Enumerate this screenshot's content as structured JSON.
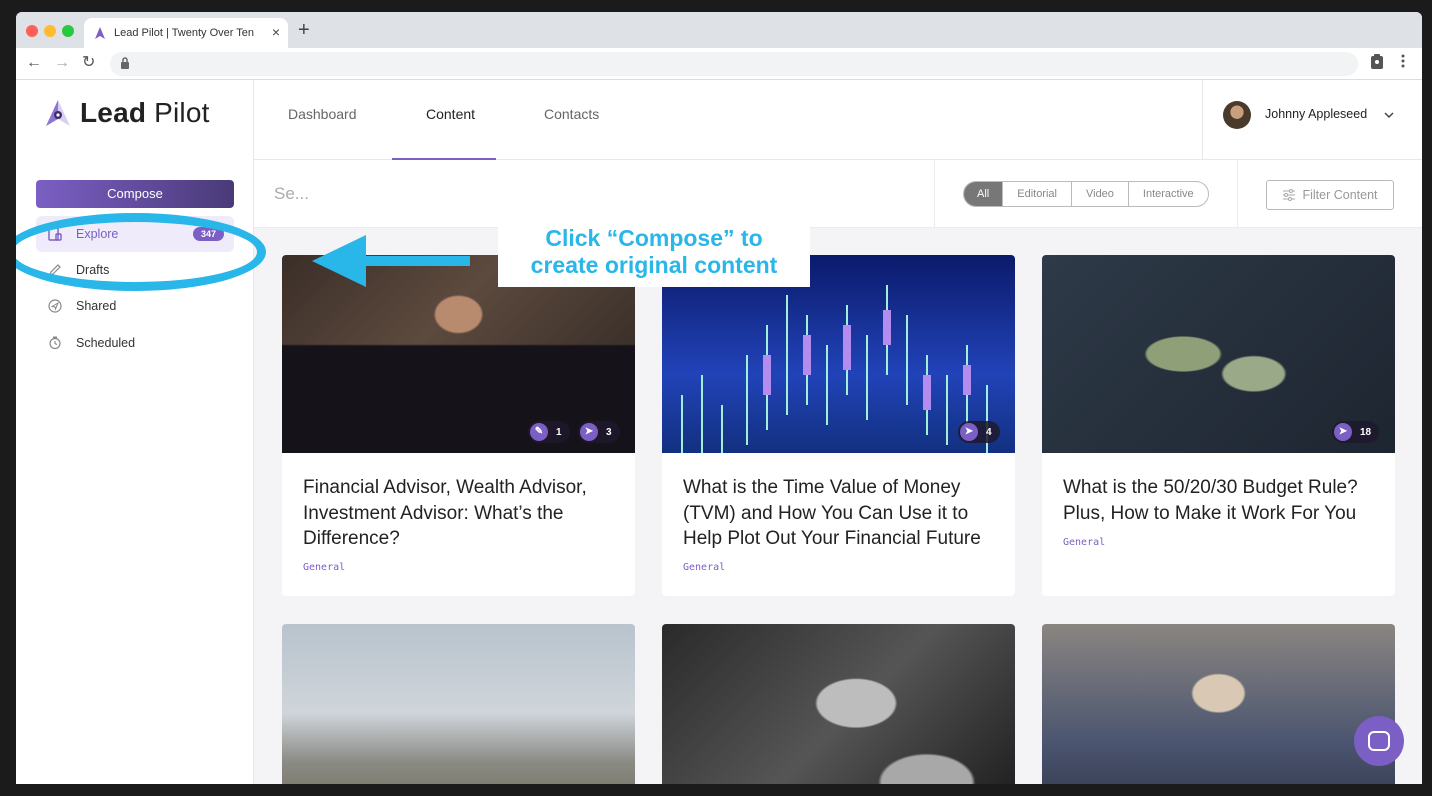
{
  "browser": {
    "tab_title": "Lead Pilot | Twenty Over Ten",
    "tab_close": "×",
    "new_tab": "+",
    "back": "←",
    "forward": "→",
    "reload": "↻"
  },
  "sidebar": {
    "logo_bold": "Lead",
    "logo_light": "Pilot",
    "compose_label": "Compose",
    "items": [
      {
        "label": "Explore",
        "badge": "347",
        "icon": "explore-icon"
      },
      {
        "label": "Drafts",
        "icon": "pencil-icon"
      },
      {
        "label": "Shared",
        "icon": "send-icon"
      },
      {
        "label": "Scheduled",
        "icon": "clock-icon"
      }
    ]
  },
  "topnav": {
    "tabs": [
      "Dashboard",
      "Content",
      "Contacts"
    ],
    "active_tab": "Content",
    "user_name": "Johnny Appleseed"
  },
  "filterbar": {
    "search_text": "Se...",
    "segments": [
      "All",
      "Editorial",
      "Video",
      "Interactive"
    ],
    "filter_label": "Filter Content"
  },
  "annotation": {
    "line1": "Click “Compose” to",
    "line2": "create original content",
    "color": "#29b6e8"
  },
  "cards": [
    {
      "title": "Financial Advisor, Wealth Advisor, Investment Advisor: What’s the Difference?",
      "tag": "General",
      "stats": [
        "1",
        "3"
      ]
    },
    {
      "title": "What is the Time Value of Money (TVM) and How You Can Use it to Help Plot Out Your Financial Future",
      "tag": "General",
      "stats": [
        "4"
      ]
    },
    {
      "title": "What is the 50/20/30 Budget Rule? Plus, How to Make it Work For You",
      "tag": "General",
      "stats": [
        "18"
      ]
    }
  ],
  "colors": {
    "accent": "#7b5fc4",
    "annotation": "#29b6e8"
  }
}
